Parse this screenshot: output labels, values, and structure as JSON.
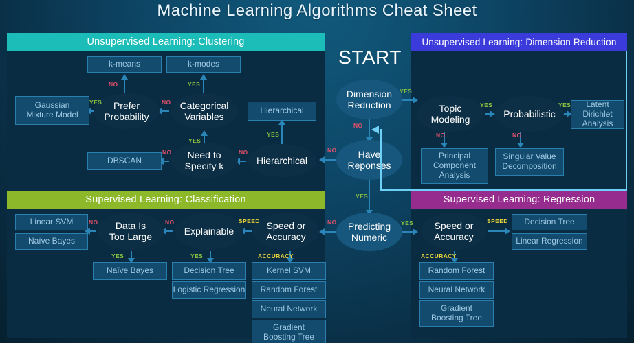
{
  "header": {
    "title": "Machine Learning Algorithms Cheat Sheet"
  },
  "colors": {
    "background": "#0a2f46",
    "panel_body": "#0a2c42",
    "clustering_header": "#1cbdb8",
    "dimension_reduction_header": "#3b3bdb",
    "classification_header": "#8cb829",
    "regression_header": "#962d8e",
    "decision_node": "#0d2f46",
    "leaf_node": "#124b6d",
    "edge": "#2a86b8",
    "feedback_connector": "#6fd0f5",
    "yes_label": "#8cc63e",
    "no_label": "#e0506a",
    "speed_label": "#e8d43a"
  },
  "center": {
    "start_label": "START",
    "nodes": [
      {
        "id": "dimension-reduction",
        "label": "Dimension\nReduction",
        "line1": "Dimension",
        "line2": "Reduction"
      },
      {
        "id": "have-responses",
        "label": "Have Reponses",
        "line1": "Have",
        "line2": "Reponses"
      },
      {
        "id": "predicting-numeric",
        "label": "Predicting Numeric",
        "line1": "Predicting",
        "line2": "Numeric"
      }
    ],
    "edge_labels": {
      "dr_yes": "YES",
      "dr_no": "NO",
      "hr_no": "NO",
      "hr_yes": "YES",
      "pn_no": "NO",
      "pn_yes": "YES"
    }
  },
  "panels": {
    "clustering": {
      "title": "Unsupervised Learning: Clustering",
      "decisions": [
        {
          "id": "prefer-probability",
          "line1": "Prefer",
          "line2": "Probability"
        },
        {
          "id": "categorical-variables",
          "line1": "Categorical",
          "line2": "Variables"
        },
        {
          "id": "need-to-specify-k",
          "line1": "Need to",
          "line2": "Specify k"
        },
        {
          "id": "hierarchical-decision",
          "line1": "Hierarchical",
          "line2": ""
        }
      ],
      "leaves": [
        {
          "id": "k-means",
          "label": "k-means"
        },
        {
          "id": "k-modes",
          "label": "k-modes"
        },
        {
          "id": "gaussian-mixture-model",
          "line1": "Gaussian",
          "line2": "Mixture Model"
        },
        {
          "id": "hierarchical-leaf",
          "label": "Hierarchical"
        },
        {
          "id": "dbscan",
          "label": "DBSCAN"
        },
        {
          "id": "hierarchical-leaf-2",
          "label": "Hierarchical"
        }
      ],
      "edge_labels": {
        "kmeans_no": "NO",
        "kmodes_yes": "YES",
        "gmm_yes": "YES",
        "catvar_no": "NO",
        "specifyk_yes": "YES",
        "hier_yes": "YES",
        "dbscan_no": "NO",
        "hier_no": "NO"
      }
    },
    "dimension_reduction": {
      "title": "Unsupervised Learning: Dimension Reduction",
      "decisions": [
        {
          "id": "topic-modeling",
          "line1": "Topic",
          "line2": "Modeling"
        },
        {
          "id": "probabilistic",
          "line1": "Probabilistic",
          "line2": ""
        }
      ],
      "leaves": [
        {
          "id": "latent-dirichlet-allocation",
          "line1": "Latent Dirichlet",
          "line2": "Analysis"
        },
        {
          "id": "principal-component-analysis",
          "line1": "Principal",
          "line2": "Component",
          "line3": "Analysis"
        },
        {
          "id": "singular-value-decomposition",
          "line1": "Singular Value",
          "line2": "Decomposition"
        }
      ],
      "edge_labels": {
        "topic_yes": "YES",
        "prob_yes": "YES",
        "topic_no": "NO",
        "prob_no": "NO"
      }
    },
    "classification": {
      "title": "Supervised Learning: Classification",
      "decisions": [
        {
          "id": "data-is-too-large",
          "line1": "Data Is",
          "line2": "Too Large"
        },
        {
          "id": "explainable",
          "line1": "Explainable",
          "line2": ""
        },
        {
          "id": "speed-or-accuracy-clf",
          "line1": "Speed or",
          "line2": "Accuracy"
        }
      ],
      "leaves": [
        {
          "id": "linear-svm",
          "label": "Linear SVM"
        },
        {
          "id": "naive-bayes-left",
          "label": "Naïve Bayes"
        },
        {
          "id": "naive-bayes-bottom",
          "label": "Naïve Bayes"
        },
        {
          "id": "decision-tree-clf",
          "label": "Decision Tree"
        },
        {
          "id": "logistic-regression",
          "label": "Logistic Regression"
        },
        {
          "id": "kernel-svm",
          "label": "Kernel SVM"
        },
        {
          "id": "random-forest-clf",
          "label": "Random Forest"
        },
        {
          "id": "neural-network-clf",
          "label": "Neural Network"
        },
        {
          "id": "gradient-boosting-tree-clf",
          "line1": "Gradient",
          "line2": "Boosting Tree"
        }
      ],
      "edge_labels": {
        "toolarge_no": "NO",
        "explainable_no": "NO",
        "speed": "SPEED",
        "toolarge_yes": "YES",
        "explainable_yes": "YES",
        "accuracy": "ACCURACY"
      }
    },
    "regression": {
      "title": "Supervised Learning: Regression",
      "decisions": [
        {
          "id": "speed-or-accuracy-reg",
          "line1": "Speed or",
          "line2": "Accuracy"
        }
      ],
      "leaves": [
        {
          "id": "decision-tree-reg",
          "label": "Decision Tree"
        },
        {
          "id": "linear-regression",
          "label": "Linear Regression"
        },
        {
          "id": "random-forest-reg",
          "label": "Random Forest"
        },
        {
          "id": "neural-network-reg",
          "label": "Neural Network"
        },
        {
          "id": "gradient-boosting-tree-reg",
          "line1": "Gradient",
          "line2": "Boosting Tree"
        }
      ],
      "edge_labels": {
        "speed": "SPEED",
        "accuracy": "ACCURACY"
      }
    }
  }
}
